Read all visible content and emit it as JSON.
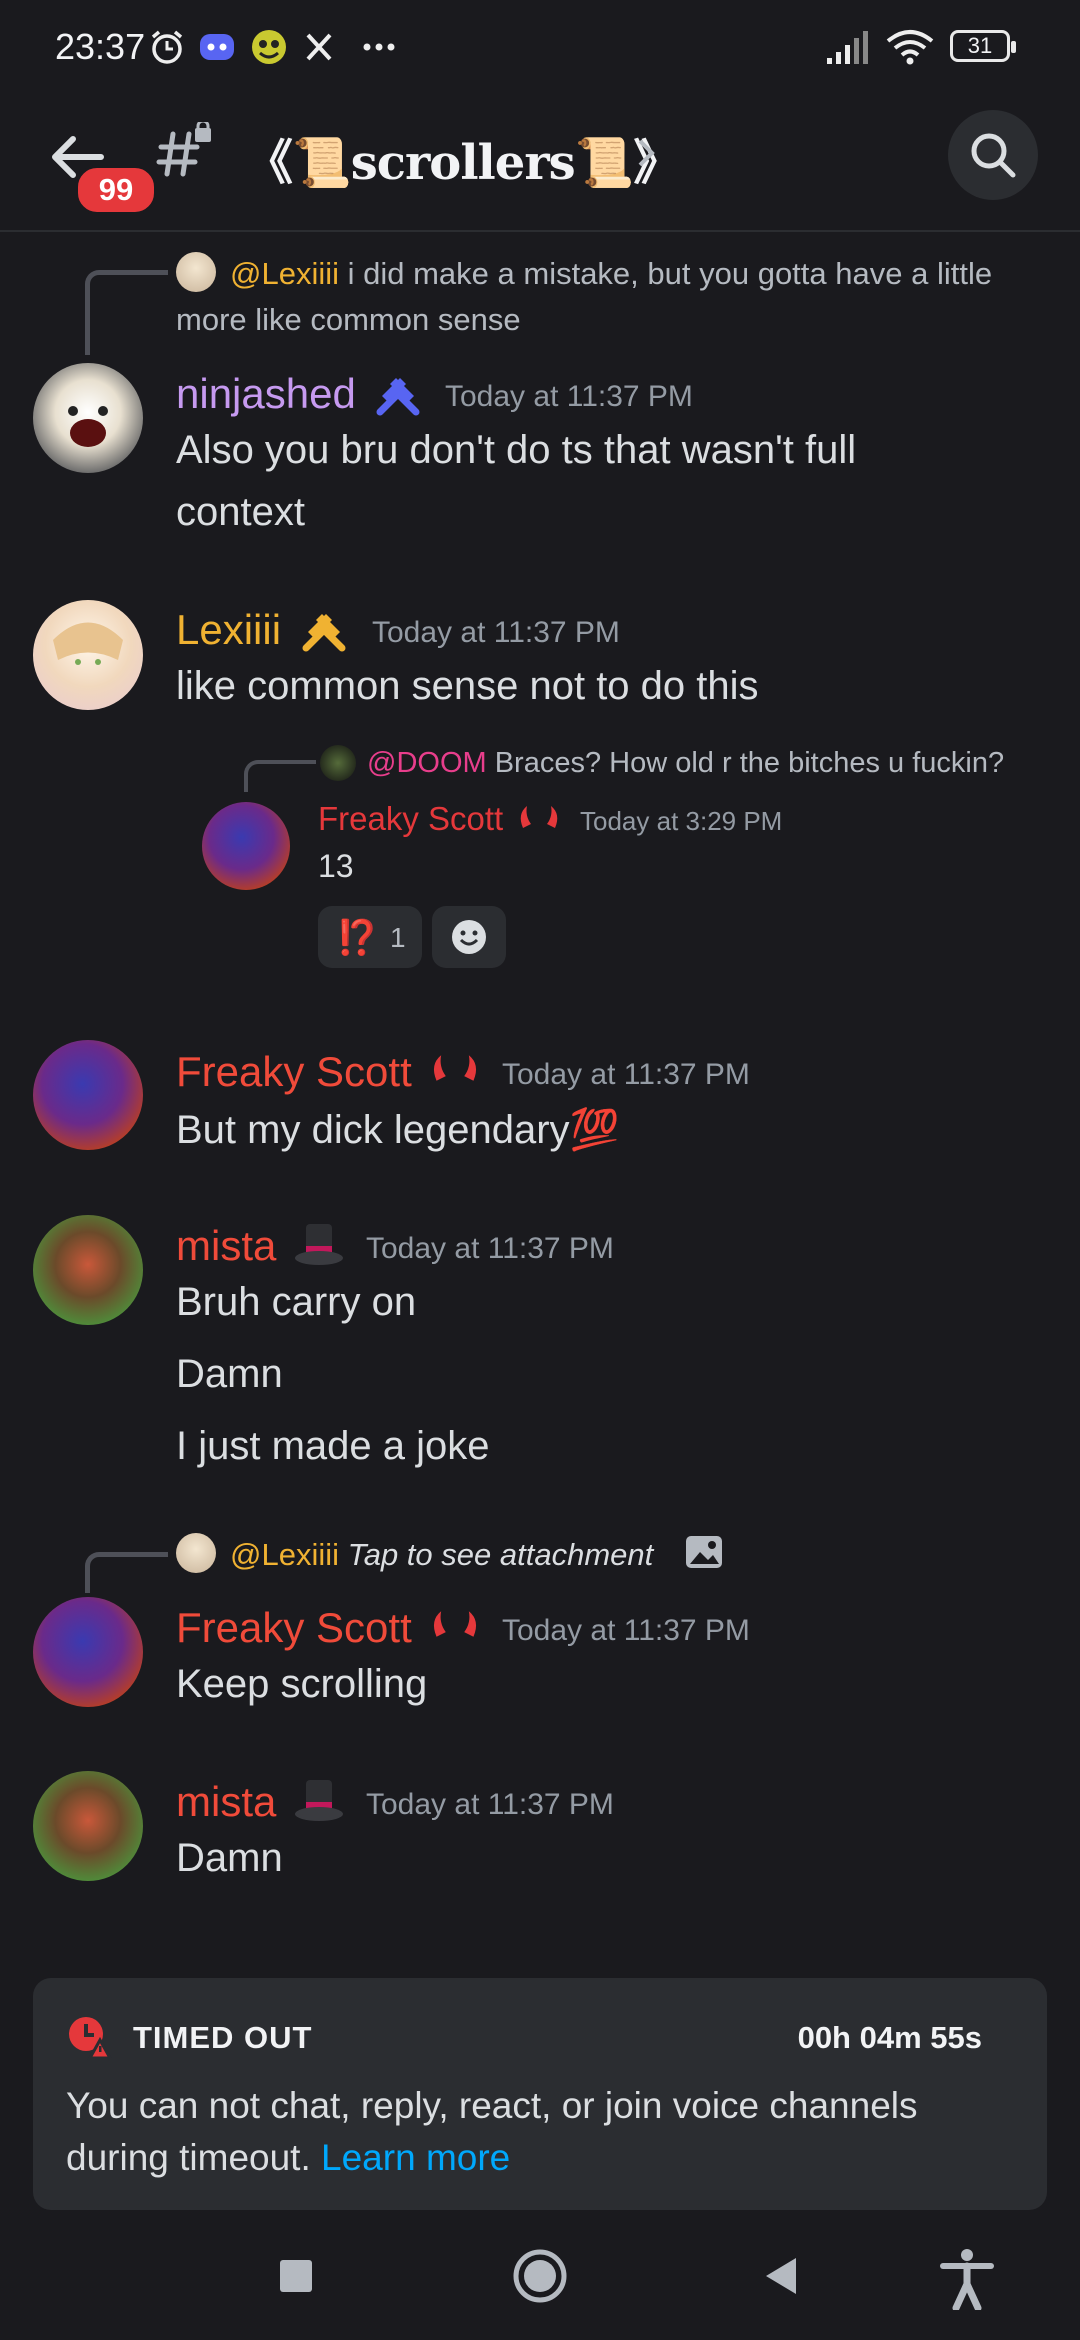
{
  "status_bar": {
    "time": "23:37",
    "battery": "31",
    "icons": [
      "alarm-icon",
      "discord-icon",
      "app-icon",
      "x-icon",
      "more-icon",
      "signal-icon",
      "wifi-icon",
      "battery-icon"
    ]
  },
  "header": {
    "unread_count": "99",
    "channel_name": "《📜scrollers📜》"
  },
  "messages": [
    {
      "reply": {
        "mention": "@Lexiiii",
        "line1": " i did make a mistake, but you gotta have a little",
        "line2": "more like common sense"
      },
      "author": "ninjashed",
      "author_color": "#c69af0",
      "timestamp": "Today at 11:37 PM",
      "lines": [
        "Also you bru don't do ts that wasn't full",
        "context"
      ]
    },
    {
      "author": "Lexiiii",
      "author_color": "#f0b232",
      "timestamp": "Today at 11:37 PM",
      "lines": [
        "like common sense not to do this"
      ],
      "forwarded": {
        "reply_mention": "@DOOM",
        "reply_text": "Braces? How old r the bitches u fuckin?",
        "author": "Freaky Scott",
        "timestamp": "Today at 3:29 PM",
        "text": "13",
        "reactions": [
          {
            "emoji": "⁉️",
            "count": "1"
          }
        ]
      }
    },
    {
      "author": "Freaky Scott",
      "author_color": "#f04b3a",
      "timestamp": "Today at 11:37 PM",
      "lines": [
        "But my dick legendary💯"
      ]
    },
    {
      "author": "mista",
      "author_color": "#f04b3a",
      "timestamp": "Today at 11:37 PM",
      "lines": [
        "Bruh carry on",
        "Damn",
        "I just made a joke"
      ]
    },
    {
      "reply": {
        "mention": "@Lexiiii",
        "attachment_text": "Tap to see attachment"
      },
      "author": "Freaky Scott",
      "author_color": "#f04b3a",
      "timestamp": "Today at 11:37 PM",
      "lines": [
        "Keep scrolling"
      ]
    },
    {
      "author": "mista",
      "author_color": "#f04b3a",
      "timestamp": "Today at 11:37 PM",
      "lines": [
        "Damn"
      ]
    }
  ],
  "timeout": {
    "title": "TIMED OUT",
    "timer": "00h 04m 55s",
    "body": "You can not chat, reply, react, or join voice channels during timeout. ",
    "link": "Learn more"
  },
  "colors": {
    "background": "#1a1a1e",
    "mention": "#f0b232",
    "link": "#00a8fc",
    "danger": "#e5383b"
  }
}
